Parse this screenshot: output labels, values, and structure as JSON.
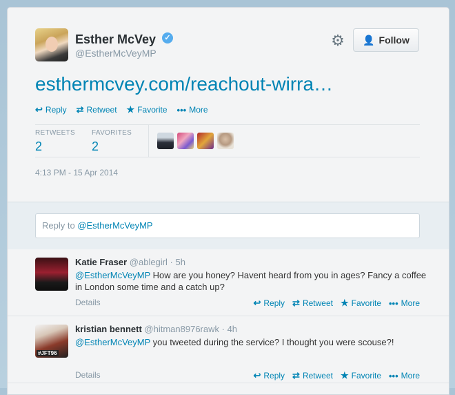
{
  "tweet": {
    "author_name": "Esther McVey",
    "author_handle": "@EstherMcVeyMP",
    "verified_glyph": "✓",
    "link_text": "esthermcvey.com/reachout-wirra…",
    "follow_label": "Follow",
    "actions": {
      "reply": "Reply",
      "retweet": "Retweet",
      "favorite": "Favorite",
      "more": "More"
    },
    "stats": {
      "retweets_label": "RETWEETS",
      "retweets_value": "2",
      "favorites_label": "FAVORITES",
      "favorites_value": "2"
    },
    "timestamp": "4:13 PM - 15 Apr 2014"
  },
  "reply_box": {
    "prefix": "Reply to ",
    "mention": "@EstherMcVeyMP"
  },
  "replies": [
    {
      "name": "Katie Fraser",
      "handle": "@ablegirl",
      "time": "· 5h",
      "mention": "@EstherMcVeyMP",
      "text": " How are you honey? Havent heard from you in ages? Fancy a coffee in London some time and a catch up?",
      "details": "Details"
    },
    {
      "name": "kristian bennett",
      "handle": "@hitman8976rawk",
      "time": "· 4h",
      "mention": "@EstherMcVeyMP",
      "text": " you tweeted during the service? I thought you were scouse?!",
      "details": "Details",
      "avatar_text": "#JFT96"
    }
  ],
  "icons": [
    "reply-icon",
    "retweet-icon",
    "star-icon",
    "more-dots-icon",
    "gear-icon",
    "follow-person-icon",
    "verified-icon"
  ],
  "colors": {
    "link": "#0084b4",
    "verified": "#55acee",
    "muted": "#8899a6",
    "background": "#f3f4f5"
  }
}
